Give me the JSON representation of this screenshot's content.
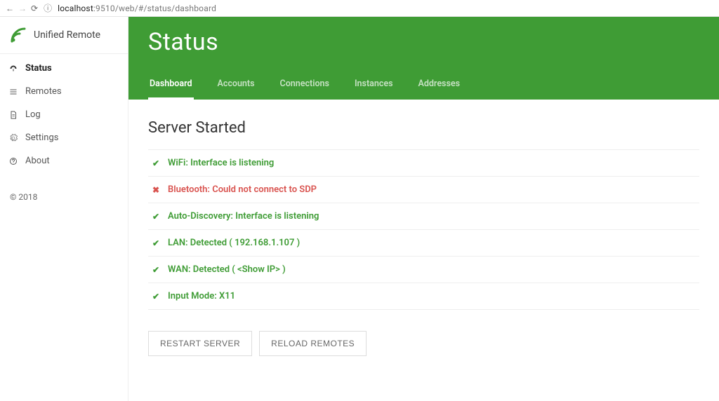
{
  "browser": {
    "url_host": "localhost",
    "url_port": ":9510",
    "url_path": "/web/#/status/dashboard"
  },
  "brand": {
    "title": "Unified Remote"
  },
  "sidebar": {
    "items": [
      {
        "label": "Status",
        "icon": "dashboard-icon",
        "active": true
      },
      {
        "label": "Remotes",
        "icon": "list-icon",
        "active": false
      },
      {
        "label": "Log",
        "icon": "file-icon",
        "active": false
      },
      {
        "label": "Settings",
        "icon": "gear-icon",
        "active": false
      },
      {
        "label": "About",
        "icon": "question-icon",
        "active": false
      }
    ],
    "footer": "© 2018"
  },
  "header": {
    "title": "Status",
    "tabs": [
      {
        "label": "Dashboard",
        "active": true
      },
      {
        "label": "Accounts",
        "active": false
      },
      {
        "label": "Connections",
        "active": false
      },
      {
        "label": "Instances",
        "active": false
      },
      {
        "label": "Addresses",
        "active": false
      }
    ]
  },
  "content": {
    "section_title": "Server Started",
    "status_items": [
      {
        "ok": true,
        "text": "WiFi: Interface is listening"
      },
      {
        "ok": false,
        "text": "Bluetooth: Could not connect to SDP"
      },
      {
        "ok": true,
        "text": "Auto-Discovery: Interface is listening"
      },
      {
        "ok": true,
        "text": "LAN: Detected ( 192.168.1.107 )"
      },
      {
        "ok": true,
        "text": "WAN: Detected ( <Show IP> )"
      },
      {
        "ok": true,
        "text": "Input Mode: X11"
      }
    ],
    "buttons": {
      "restart": "RESTART SERVER",
      "reload": "RELOAD REMOTES"
    }
  },
  "colors": {
    "brand_green": "#3f9c35",
    "error_red": "#d9534f"
  }
}
